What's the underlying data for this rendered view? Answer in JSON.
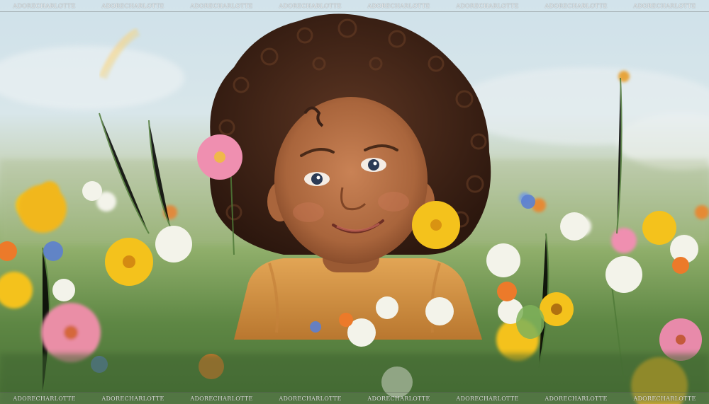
{
  "image": {
    "subject": "child-in-wildflower-meadow",
    "palette": {
      "sky": "#cfe1ea",
      "grass": "#5e8744",
      "skin": "#b9744a",
      "hair": "#3a2116",
      "shirt": "#d99a45",
      "flower_yellow": "#f4c21c",
      "flower_pink": "#ef8fb0",
      "flower_white": "#f3f3ea"
    }
  },
  "watermark": {
    "text": "ADORECHARLOTTE"
  }
}
